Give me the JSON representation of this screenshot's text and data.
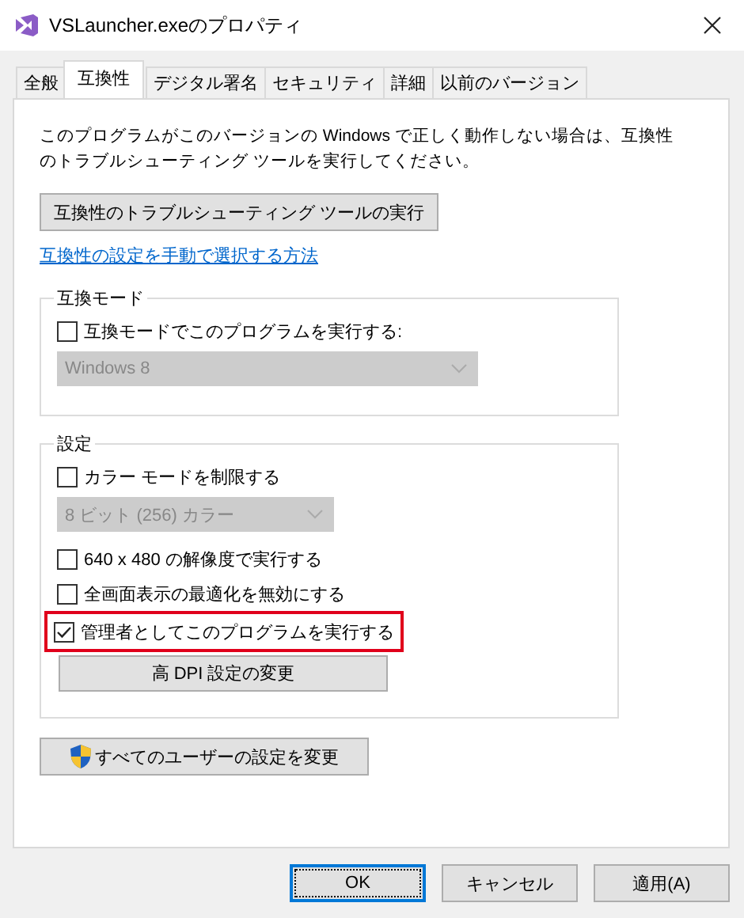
{
  "window": {
    "title": "VSLauncher.exeのプロパティ"
  },
  "tabs": [
    {
      "label": "全般",
      "selected": false
    },
    {
      "label": "互換性",
      "selected": true
    },
    {
      "label": "デジタル署名",
      "selected": false
    },
    {
      "label": "セキュリティ",
      "selected": false
    },
    {
      "label": "詳細",
      "selected": false
    },
    {
      "label": "以前のバージョン",
      "selected": false
    }
  ],
  "description": "このプログラムがこのバージョンの Windows で正しく動作しない場合は、互換性のトラブルシューティング ツールを実行してください。",
  "troubleshoot_button": "互換性のトラブルシューティング ツールの実行",
  "help_link": "互換性の設定を手動で選択する方法",
  "groups": [
    {
      "title": "互換モード",
      "items": [
        {
          "kind": "checkbox",
          "label": "互換モードでこのプログラムを実行する:",
          "checked": false,
          "highlighted": false
        },
        {
          "kind": "dropdown",
          "value": "Windows 8",
          "disabled": true,
          "wide": true
        }
      ]
    },
    {
      "title": "設定",
      "items": [
        {
          "kind": "checkbox",
          "label": "カラー モードを制限する",
          "checked": false,
          "highlighted": false
        },
        {
          "kind": "dropdown",
          "value": "8 ビット (256) カラー",
          "disabled": true,
          "wide": false
        },
        {
          "kind": "checkbox",
          "label": "640 x 480 の解像度で実行する",
          "checked": false,
          "highlighted": false
        },
        {
          "kind": "checkbox",
          "label": "全画面表示の最適化を無効にする",
          "checked": false,
          "highlighted": false
        },
        {
          "kind": "checkbox",
          "label": "管理者としてこのプログラムを実行する",
          "checked": true,
          "highlighted": true
        },
        {
          "kind": "button",
          "label": "高 DPI 設定の変更"
        }
      ]
    }
  ],
  "all_users_button": "すべてのユーザーの設定を変更",
  "buttons": [
    {
      "label": "OK",
      "default": true
    },
    {
      "label": "キャンセル",
      "default": false
    },
    {
      "label": "適用(A)",
      "default": false
    }
  ]
}
